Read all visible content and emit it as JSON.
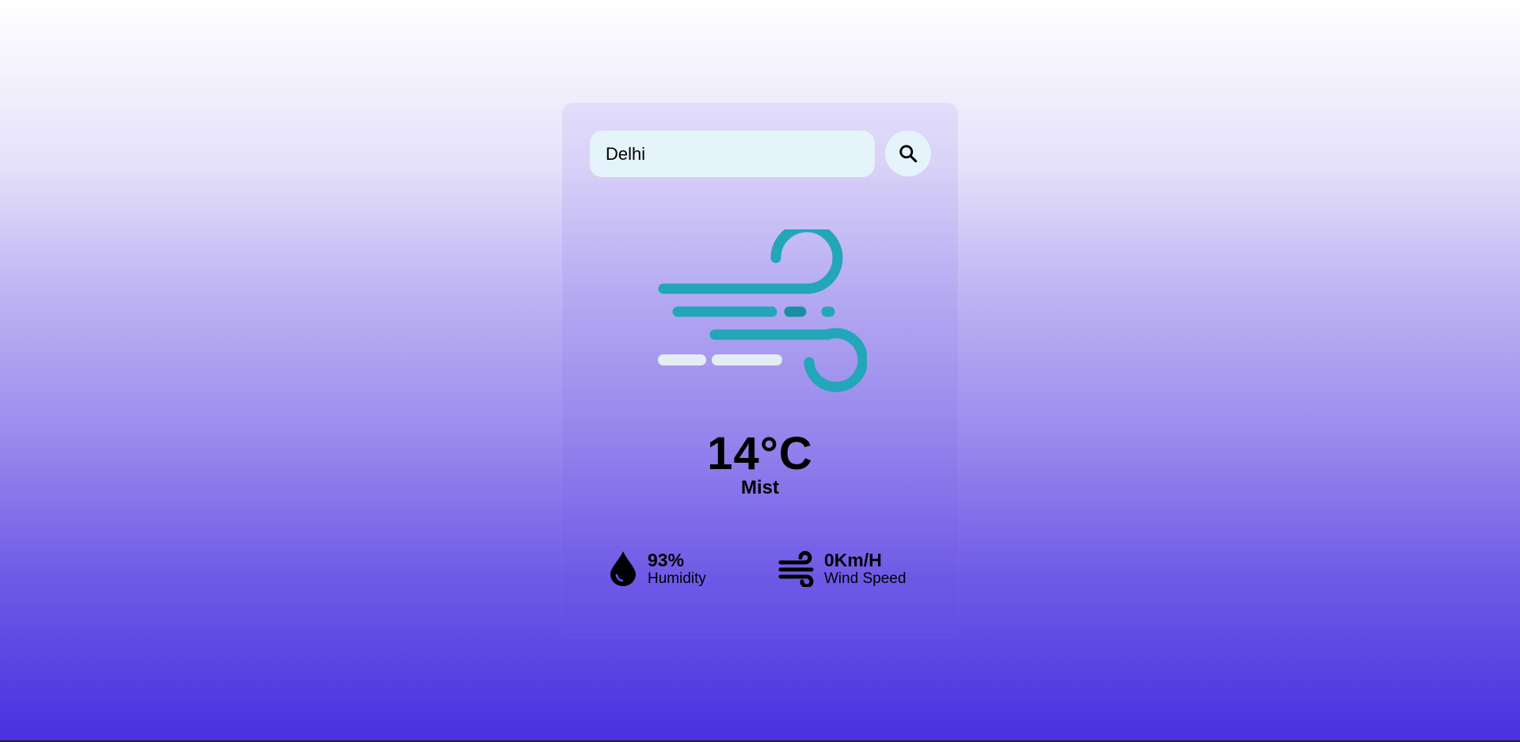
{
  "search": {
    "value": "Delhi",
    "placeholder": "",
    "icon": "search-icon"
  },
  "weather": {
    "icon": "wind-icon",
    "temperature": "14°C",
    "condition": "Mist"
  },
  "details": [
    {
      "icon": "water-drop-icon",
      "value": "93%",
      "label": "Humidity"
    },
    {
      "icon": "wind-icon",
      "value": "0Km/H",
      "label": "Wind Speed"
    }
  ],
  "colors": {
    "accent": "#4a2fe0",
    "input_bg": "#e5f4fa",
    "icon_teal": "#22a6b8"
  }
}
